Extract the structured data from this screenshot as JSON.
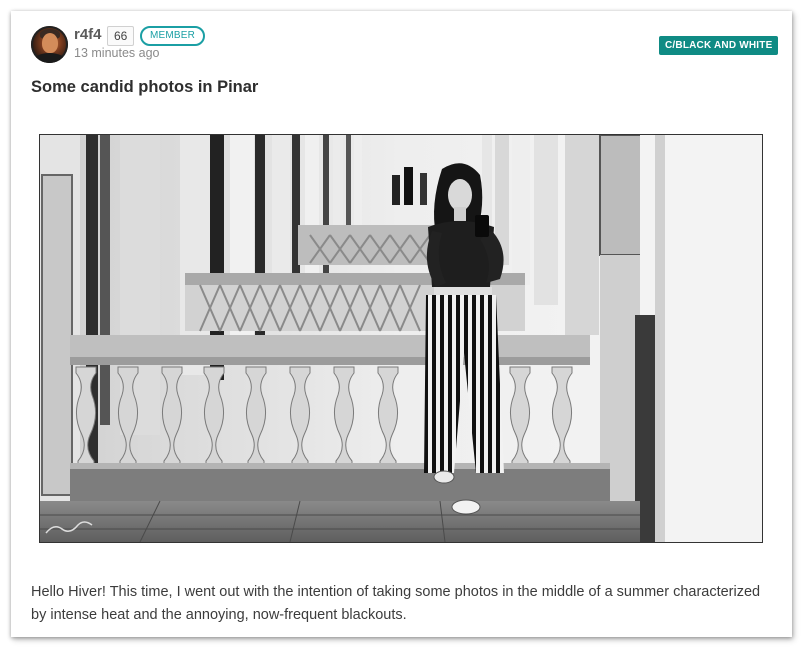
{
  "post": {
    "author": "r4f4",
    "reputation": "66",
    "role": "MEMBER",
    "timestamp": "13 minutes ago",
    "community": "C/BLACK AND WHITE",
    "title": "Some candid photos in Pinar",
    "body": "Hello Hiver! This time, I went out with the intention of taking some photos in the middle of a summer characterized by intense heat and the annoying, now-frequent blackouts."
  },
  "colors": {
    "accent_teal": "#1b9fa4",
    "tag_background": "#0f8b84",
    "text_dark": "#2e2e2e",
    "text_muted": "#8a8a8a"
  },
  "icons": {
    "avatar": "user-avatar"
  }
}
